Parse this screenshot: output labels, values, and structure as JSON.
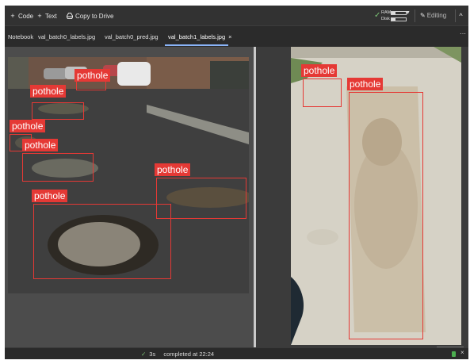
{
  "toolbar": {
    "code_label": "Code",
    "text_label": "Text",
    "copy_to_drive_label": "Copy to Drive",
    "ram_label": "RAM",
    "disk_label": "Disk",
    "ram_usage": 0.25,
    "disk_usage": 0.3,
    "editing_label": "Editing",
    "icons": {
      "add_code": "plus-icon",
      "add_text": "plus-icon",
      "copy_to_drive": "drive-icon",
      "connected": "check-icon",
      "resources_menu": "caret-down-icon",
      "editing": "pencil-icon",
      "collapse": "chevron-up-icon"
    }
  },
  "tabs": {
    "notebook_label": "Notebook",
    "items": [
      {
        "label": "val_batch0_labels.jpg",
        "active": false
      },
      {
        "label": "val_batch0_pred.jpg",
        "active": false
      },
      {
        "label": "val_batch1_labels.jpg",
        "active": true
      }
    ],
    "close_glyph": "×",
    "more_glyph": "⋯"
  },
  "viewer": {
    "detection_label": "pothole",
    "box_color": "#e53935",
    "left_image_detections": 6,
    "right_image_detections": 2
  },
  "status": {
    "check_glyph": "✓",
    "duration": "3s",
    "completed_text": "completed at 22:24",
    "close_glyph": "×"
  }
}
